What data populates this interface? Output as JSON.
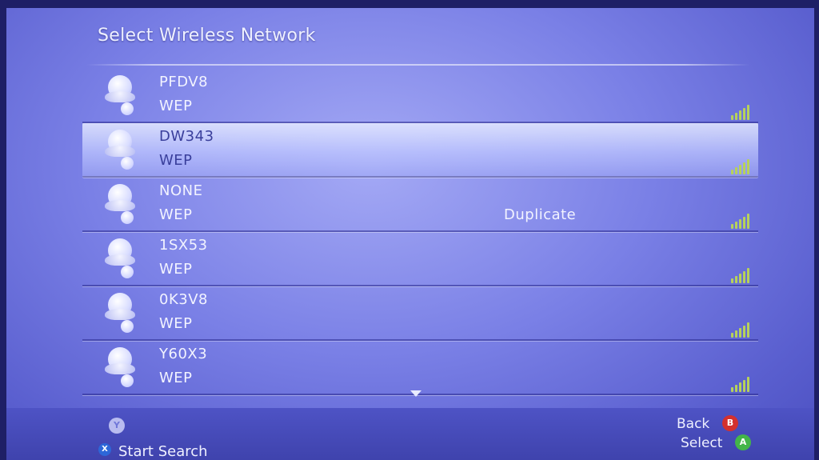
{
  "header": {
    "title": "Select Wireless Network"
  },
  "networks": [
    {
      "ssid": "PFDV8",
      "security": "WEP",
      "note": "",
      "selected": false
    },
    {
      "ssid": "DW343",
      "security": "WEP",
      "note": "",
      "selected": true
    },
    {
      "ssid": "NONE",
      "security": "WEP",
      "note": "Duplicate",
      "selected": false
    },
    {
      "ssid": "1SX53",
      "security": "WEP",
      "note": "",
      "selected": false
    },
    {
      "ssid": "0K3V8",
      "security": "WEP",
      "note": "",
      "selected": false
    },
    {
      "ssid": "Y60X3",
      "security": "WEP",
      "note": "",
      "selected": false
    }
  ],
  "footer": {
    "y_button_glyph": "Y",
    "x_button_glyph": "X",
    "start_search_label": "Start Search",
    "back_label": "Back",
    "b_button_glyph": "B",
    "select_label": "Select",
    "a_button_glyph": "A"
  },
  "icons": {
    "network": "people-icon",
    "signal": "signal-strength-icon",
    "scroll": "scroll-down-arrow-icon"
  },
  "colors": {
    "background": "#7a80e6",
    "selected_row": "#d4d9ff",
    "signal": "#b7d25a",
    "b_button": "#d3302e",
    "a_button": "#43b54a",
    "x_button": "#2d67d8"
  }
}
